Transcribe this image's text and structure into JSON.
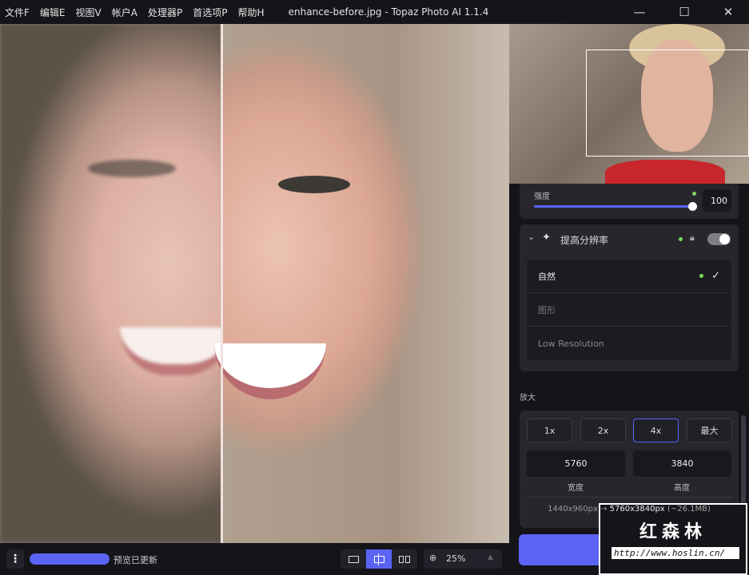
{
  "menu": [
    "文件F",
    "编辑E",
    "视图V",
    "帐户A",
    "处理器P",
    "首选项P",
    "帮助H"
  ],
  "window": {
    "title": "enhance-before.jpg - Topaz Photo AI 1.1.4",
    "minimize": "—",
    "maximize": "☐",
    "close": "✕"
  },
  "strength": {
    "label": "强度",
    "value": "100",
    "level": 1.0
  },
  "upscale": {
    "title": "提高分辨率",
    "enabled": true,
    "models": [
      {
        "label": "自然",
        "selected": true
      },
      {
        "label": "图形"
      },
      {
        "label": "Low Resolution"
      }
    ]
  },
  "scale": {
    "section": "放大",
    "options": [
      "1x",
      "2x",
      "4x",
      "最大"
    ],
    "selected": "4x",
    "width": "5760",
    "height": "3840",
    "width_label": "宽度",
    "height_label": "高度",
    "source": "1440x960px",
    "arrow": "→",
    "output": "5760x3840px",
    "size": "(~26.1MB)"
  },
  "bottom": {
    "status": "预览已更新",
    "progress": 1.0,
    "zoom": "25%"
  },
  "watermark": {
    "name": "红森林",
    "url": "http://www.hoslin.cn/"
  },
  "colors": {
    "accent": "#5b63f5",
    "green": "#7ed957"
  }
}
